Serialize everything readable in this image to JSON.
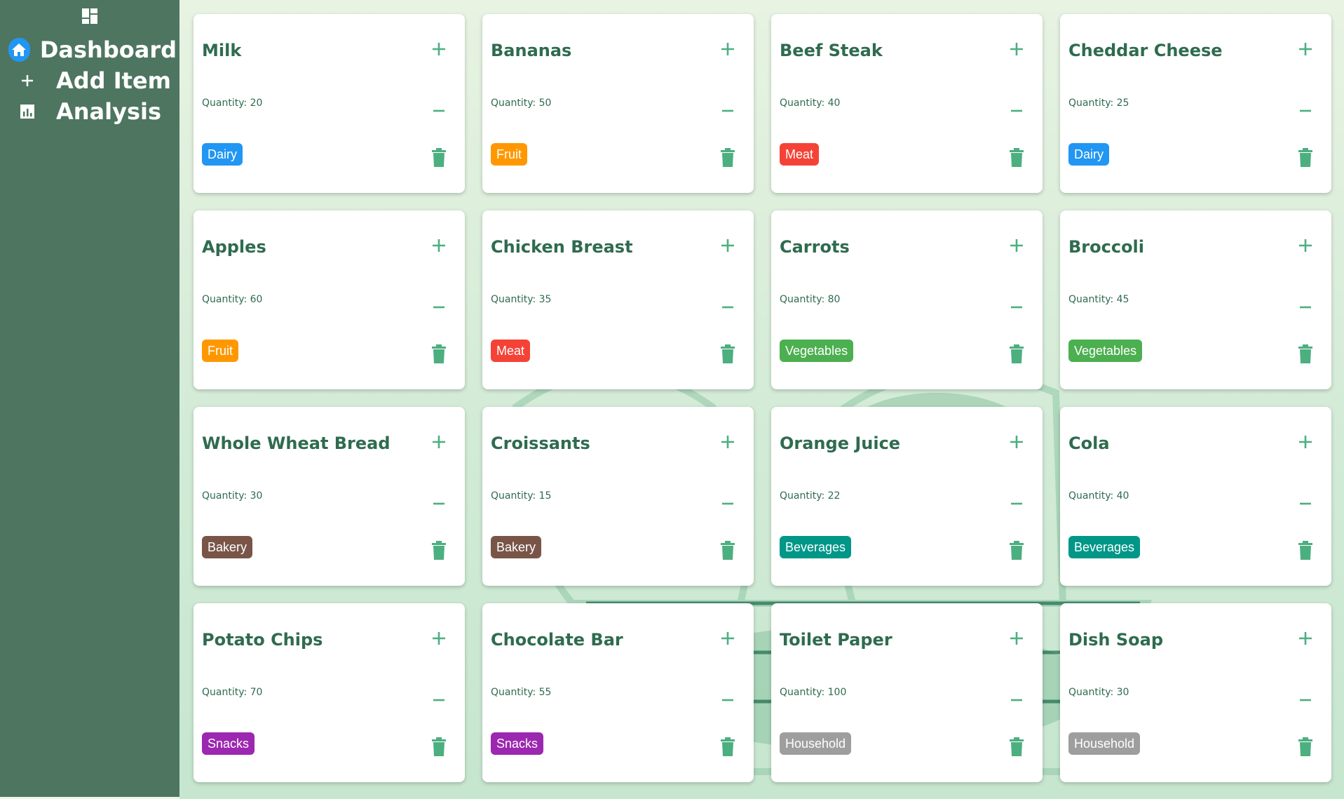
{
  "sidebar": {
    "logo_icon": "dashboard-grid-icon",
    "items": [
      {
        "label": "Dashboard",
        "icon": "home-icon",
        "active": true
      },
      {
        "label": "Add Item",
        "icon": "plus-icon",
        "active": false
      },
      {
        "label": "Analysis",
        "icon": "bar-chart-icon",
        "active": false
      }
    ]
  },
  "colors": {
    "sidebar_bg": "#4e7560",
    "accent": "#2196f3",
    "action_green": "#4caf80",
    "title_green": "#2f6b4f"
  },
  "category_colors": {
    "Dairy": "#2196f3",
    "Fruit": "#ff9800",
    "Meat": "#f44336",
    "Vegetables": "#4caf50",
    "Bakery": "#795548",
    "Beverages": "#009688",
    "Snacks": "#9c27b0",
    "Household": "#9e9e9e"
  },
  "items": [
    {
      "name": "Milk",
      "quantity_text": "Quantity: 20",
      "category": "Dairy"
    },
    {
      "name": "Bananas",
      "quantity_text": "Quantity: 50",
      "category": "Fruit"
    },
    {
      "name": "Beef Steak",
      "quantity_text": "Quantity: 40",
      "category": "Meat"
    },
    {
      "name": "Cheddar Cheese",
      "quantity_text": "Quantity: 25",
      "category": "Dairy"
    },
    {
      "name": "Apples",
      "quantity_text": "Quantity: 60",
      "category": "Fruit"
    },
    {
      "name": "Chicken Breast",
      "quantity_text": "Quantity: 35",
      "category": "Meat"
    },
    {
      "name": "Carrots",
      "quantity_text": "Quantity: 80",
      "category": "Vegetables"
    },
    {
      "name": "Broccoli",
      "quantity_text": "Quantity: 45",
      "category": "Vegetables"
    },
    {
      "name": "Whole Wheat Bread",
      "quantity_text": "Quantity: 30",
      "category": "Bakery"
    },
    {
      "name": "Croissants",
      "quantity_text": "Quantity: 15",
      "category": "Bakery"
    },
    {
      "name": "Orange Juice",
      "quantity_text": "Quantity: 22",
      "category": "Beverages"
    },
    {
      "name": "Cola",
      "quantity_text": "Quantity: 40",
      "category": "Beverages"
    },
    {
      "name": "Potato Chips",
      "quantity_text": "Quantity: 70",
      "category": "Snacks"
    },
    {
      "name": "Chocolate Bar",
      "quantity_text": "Quantity: 55",
      "category": "Snacks"
    },
    {
      "name": "Toilet Paper",
      "quantity_text": "Quantity: 100",
      "category": "Household"
    },
    {
      "name": "Dish Soap",
      "quantity_text": "Quantity: 30",
      "category": "Household"
    }
  ]
}
